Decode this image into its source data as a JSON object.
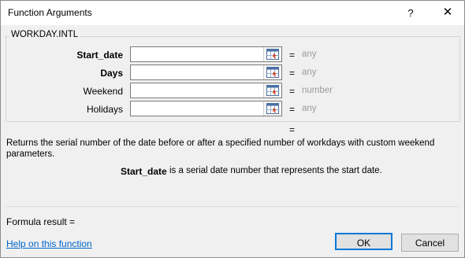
{
  "window": {
    "title": "Function Arguments",
    "help_glyph": "?",
    "close_glyph": "✕"
  },
  "function": {
    "name": "WORKDAY.INTL",
    "arguments": [
      {
        "label": "Start_date",
        "bold": true,
        "value": "",
        "result": "any"
      },
      {
        "label": "Days",
        "bold": true,
        "value": "",
        "result": "any"
      },
      {
        "label": "Weekend",
        "bold": false,
        "value": "",
        "result": "number"
      },
      {
        "label": "Holidays",
        "bold": false,
        "value": "",
        "result": "any"
      }
    ],
    "equals": "=",
    "description": "Returns the serial number of the date before or after a specified number of workdays with custom weekend parameters.",
    "arg_help_name": "Start_date",
    "arg_help_text": "is a serial date number that represents the start date."
  },
  "footer": {
    "formula_result_label": "Formula result =",
    "help_link": "Help on this function",
    "ok_label": "OK",
    "cancel_label": "Cancel"
  },
  "colors": {
    "link": "#0066cc",
    "default_button_border": "#0078d7",
    "muted_value": "#9a9a9a"
  },
  "icons": {
    "ref_button": "range-select-icon"
  }
}
